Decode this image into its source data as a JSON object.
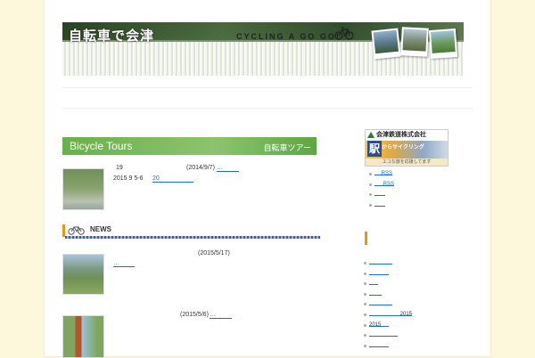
{
  "header": {
    "title": "自転車で会津",
    "slogan": "CYCLING A GO GO!"
  },
  "tours": {
    "title": "Bicycle Tours",
    "subtitle": "自転車ツアー",
    "entry1_line1_num": "19",
    "entry1_date": "(2014/9/7)",
    "entry1_more": "…",
    "entry1_line2": "2015 9 5-6",
    "entry1_link": "20"
  },
  "news": {
    "title": "NEWS",
    "item1_date": "(2015/5/17)",
    "item1_more": "…",
    "item2_date": "(2015/5/6)",
    "item2_more": "…"
  },
  "sidebar": {
    "company": "会津鉄道株式会社",
    "eki": "駅",
    "eki_sub": "からサイクリング",
    "banner_bottom": "エコな旅を応援してます",
    "feeds": [
      {
        "text": "RSS"
      },
      {
        "text": "RSS"
      },
      {
        "text": ""
      },
      {
        "text": ""
      }
    ],
    "archive": [
      {
        "text": ""
      },
      {
        "text": ""
      },
      {
        "text": ""
      },
      {
        "text": ""
      },
      {
        "text": ""
      },
      {
        "text": "2015"
      },
      {
        "text": "2015"
      },
      {
        "text": ""
      },
      {
        "text": ""
      }
    ]
  },
  "colors": {
    "accent_green": "#6ab04c",
    "link_blue": "#1f6fbf",
    "news_orange": "#e8951c",
    "page_bg": "#fdf8dc"
  }
}
